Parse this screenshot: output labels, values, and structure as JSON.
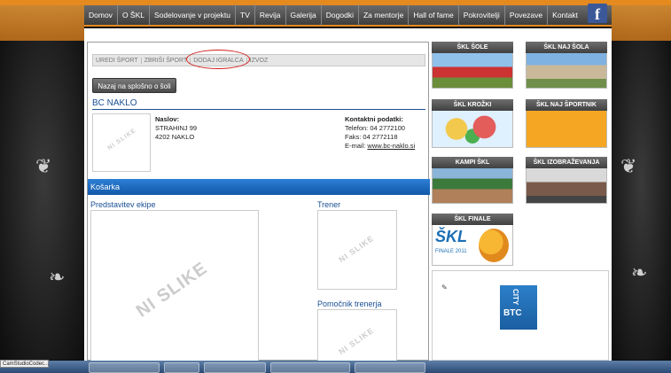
{
  "nav": {
    "items": [
      "Domov",
      "O ŠKL",
      "Sodelovanje v projektu",
      "TV",
      "Revija",
      "Galerija",
      "Dogodki",
      "Za mentorje",
      "Hall of fame",
      "Pokrovitelji",
      "Povezave",
      "Kontakt"
    ],
    "facebook_glyph": "f"
  },
  "tabs": [
    "UREDI ŠPORT",
    "ZBRIŠI ŠPORT",
    "DODAJ IGRALCA",
    "IZVOZ"
  ],
  "back_button": "Nazaj na splošno o šoli",
  "club": {
    "name": "BC NAKLO",
    "address_label": "Naslov:",
    "street": "STRAHINJ 99",
    "city": "4202 NAKLO",
    "contact_label": "Kontaktni podatki:",
    "phone": "Telefon: 04 2772100",
    "fax": "Faks: 04 2772118",
    "email_label": "E-mail: ",
    "email": "www.bc-naklo.si",
    "placeholder": "NI SLIKE"
  },
  "sport": "Košarka",
  "sections": {
    "representative": "Predstavitev ekipe",
    "coach": "Trener",
    "assistant": "Pomočnik trenerja"
  },
  "sidebar": {
    "cards": [
      "ŠKL ŠOLE",
      "ŠKL NAJ ŠOLA",
      "ŠKL KROŽKI",
      "ŠKL NAJ ŠPORTNIK",
      "KAMPI ŠKL",
      "ŠKL IZOBRAŽEVANJA",
      "ŠKL FINALE"
    ],
    "finale_logo": "ŠKL",
    "finale_sub": "FINALE 2011",
    "sponsor": "BTC",
    "sponsor_city": "CITY"
  },
  "taskbar": {
    "label": "CamStudioCodec..."
  }
}
